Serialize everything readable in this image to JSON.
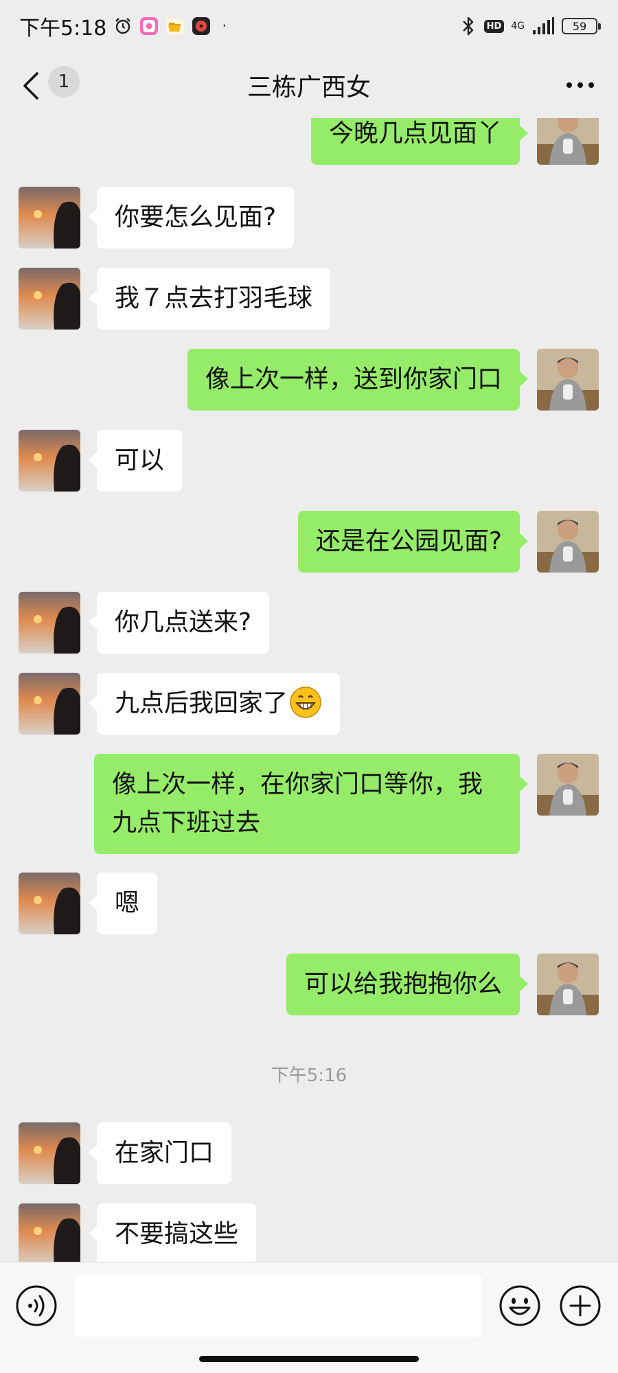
{
  "status_bar": {
    "time": "下午5:18",
    "network": "4G",
    "hd_badge": "HD",
    "battery": "59",
    "dot": "·",
    "icons": [
      "alarm-icon",
      "camera-app-icon",
      "folder-app-icon",
      "music-app-icon",
      "bluetooth-icon",
      "signal-icon"
    ]
  },
  "header": {
    "unread_count": "1",
    "title": "三栋广西女",
    "back_icon": "chevron-left-icon",
    "more_icon": "more-dots-icon"
  },
  "messages": [
    {
      "side": "out",
      "text": "今晚几点见面丫"
    },
    {
      "side": "in",
      "text": "你要怎么见面?"
    },
    {
      "side": "in",
      "text": "我７点去打羽毛球"
    },
    {
      "side": "out",
      "text": "像上次一样，送到你家门口"
    },
    {
      "side": "in",
      "text": "可以"
    },
    {
      "side": "out",
      "text": "还是在公园见面?"
    },
    {
      "side": "in",
      "text": "你几点送来?"
    },
    {
      "side": "in",
      "text": "九点后我回家了",
      "emoji": "grin-emoji"
    },
    {
      "side": "out",
      "text": "像上次一样，在你家门口等你，我九点下班过去"
    },
    {
      "side": "in",
      "text": "嗯"
    },
    {
      "side": "out",
      "text": "可以给我抱抱你么"
    },
    {
      "side": "in",
      "text": "在家门口"
    },
    {
      "side": "in",
      "text": "不要搞这些"
    }
  ],
  "timestamp": "下午5:16",
  "input_bar": {
    "voice_icon": "voice-icon",
    "input_value": "",
    "emoji_icon": "emoji-icon",
    "plus_icon": "plus-icon"
  },
  "colors": {
    "background": "#ededed",
    "outgoing_bubble": "#95ec69",
    "incoming_bubble": "#ffffff",
    "timestamp_text": "#9a9a9a"
  }
}
